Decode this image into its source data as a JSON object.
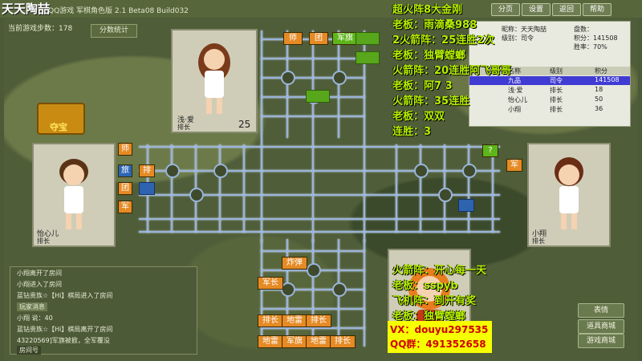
{
  "window": {
    "title": "天天陶喆",
    "subtitle": "QQ游戏 军棋角色版 2.1 Beta08 Build032",
    "buttons": [
      "分页",
      "设置",
      "返回",
      "帮助"
    ]
  },
  "status": {
    "steps_label": "当前游戏步数：",
    "steps_value": "178",
    "stats_button": "分数统计"
  },
  "players": {
    "top": {
      "name": "浅·爱",
      "rank": "排长",
      "score": "25"
    },
    "left": {
      "name": "怡心儿",
      "rank": "排长"
    },
    "right": {
      "name": "小翔",
      "rank": "排长"
    },
    "bottom": {
      "name": "",
      "rank": ""
    }
  },
  "treasure_label": "夺宝",
  "board_pieces": {
    "top": [
      "师",
      "团",
      "军旗"
    ],
    "left": [
      "师",
      "旅",
      "排",
      "团",
      "军"
    ],
    "right": [
      "?",
      "军"
    ],
    "bottom": [
      "炸弹",
      "军长",
      "排长",
      "地雷",
      "排长",
      "地雷",
      "军旗",
      "地雷",
      "排长"
    ]
  },
  "list": {
    "info": {
      "nick_label": "昵称：",
      "nick": "天天陶喆",
      "level_label": "级别：",
      "level": "司令",
      "score_label": "积分：",
      "score": "141508",
      "pan_label": "盘数：",
      "win_label": "胜率：",
      "win": "70%"
    },
    "columns": [
      "名称",
      "级别",
      "积分"
    ],
    "rows": [
      {
        "name": "九品",
        "level": "司令",
        "score": "141508"
      },
      {
        "name": "浅·爱",
        "level": "排长",
        "score": "18"
      },
      {
        "name": "怡心儿",
        "level": "排长",
        "score": "50"
      },
      {
        "name": "小翔",
        "level": "排长",
        "score": "36"
      }
    ]
  },
  "chat": [
    "小翔离开了房间",
    "小翔进入了房间",
    "蓝钻贵族☆【Hi】棋局进入了房间",
    "玩家消息",
    "小翔 说：40",
    "蓝钻贵族☆【Hi】棋局离开了房间",
    "43220569]军旗被掀，全军覆没",
    "房间号"
  ],
  "overlay_top": [
    "超火阵8大金刚",
    "老板：雨滴桑988",
    "2火箭阵：25连胜2次",
    "老板：独臂螳螂",
    "火箭阵：20连胜阿飞哥哥",
    "老板：阿7 3",
    "火箭阵：35连胜",
    "老板：双双",
    "连胜：3"
  ],
  "overlay_bottom": [
    "火箭阵：开心每一天",
    "老板：sspyb",
    "飞机阵：到开有奖",
    "老板：独臂螳螂"
  ],
  "contact": {
    "vx": "VX：douyu297535",
    "qq": "QQ群：491352658"
  },
  "side_buttons": [
    "表情",
    "道具商城",
    "游戏商城"
  ]
}
